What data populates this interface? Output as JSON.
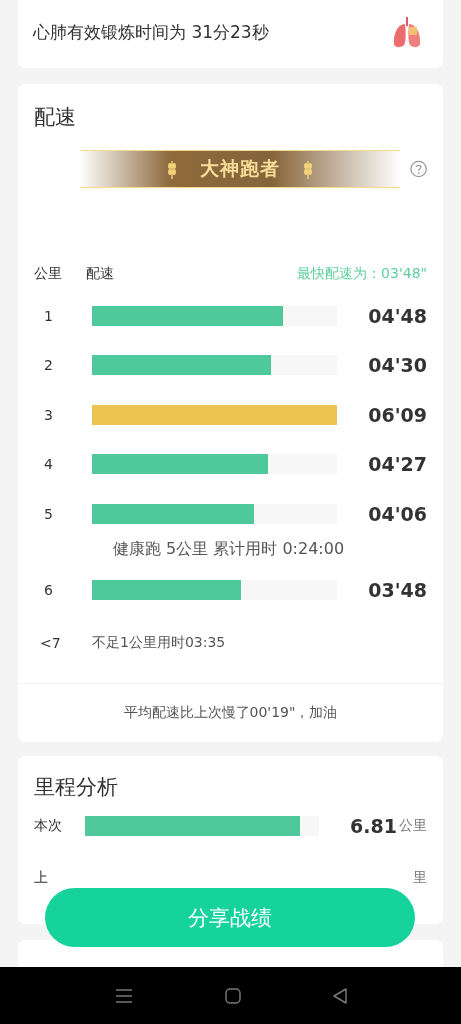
{
  "summary": {
    "text": "心肺有效锻炼时间为 31分23秒"
  },
  "pace": {
    "title": "配速",
    "badge": "大神跑者",
    "columns": [
      "公里",
      "配速"
    ],
    "fastest": "最快配速为：03'48\"",
    "rows": [
      {
        "kind": "split",
        "km": "1",
        "level": 0.78,
        "color": "#4fc89c",
        "time": "04'48"
      },
      {
        "kind": "split",
        "km": "2",
        "level": 0.73,
        "color": "#4fc89c",
        "time": "04'30"
      },
      {
        "kind": "split",
        "km": "3",
        "level": 1.0,
        "color": "#ecc550",
        "time": "06'09"
      },
      {
        "kind": "split",
        "km": "4",
        "level": 0.72,
        "color": "#4fc89c",
        "time": "04'27"
      },
      {
        "kind": "split",
        "km": "5",
        "level": 0.66,
        "color": "#4fc89c",
        "time": "04'06"
      },
      {
        "kind": "note",
        "text": "健康跑 5公里 累计用时 0:24:00"
      },
      {
        "kind": "split",
        "km": "6",
        "level": 0.61,
        "color": "#4fc89c",
        "time": "03'48"
      },
      {
        "kind": "partial",
        "km": "<7",
        "text": "不足1公里用时03:35"
      }
    ],
    "footer": "平均配速比上次慢了00'19\"，加油"
  },
  "mileage": {
    "title": "里程分析",
    "rows": [
      {
        "label": "本次",
        "level": 0.92,
        "value": "6.81",
        "unit": "公里"
      },
      {
        "label": "上",
        "unit": "里"
      }
    ]
  },
  "share_button": "分享战绩"
}
